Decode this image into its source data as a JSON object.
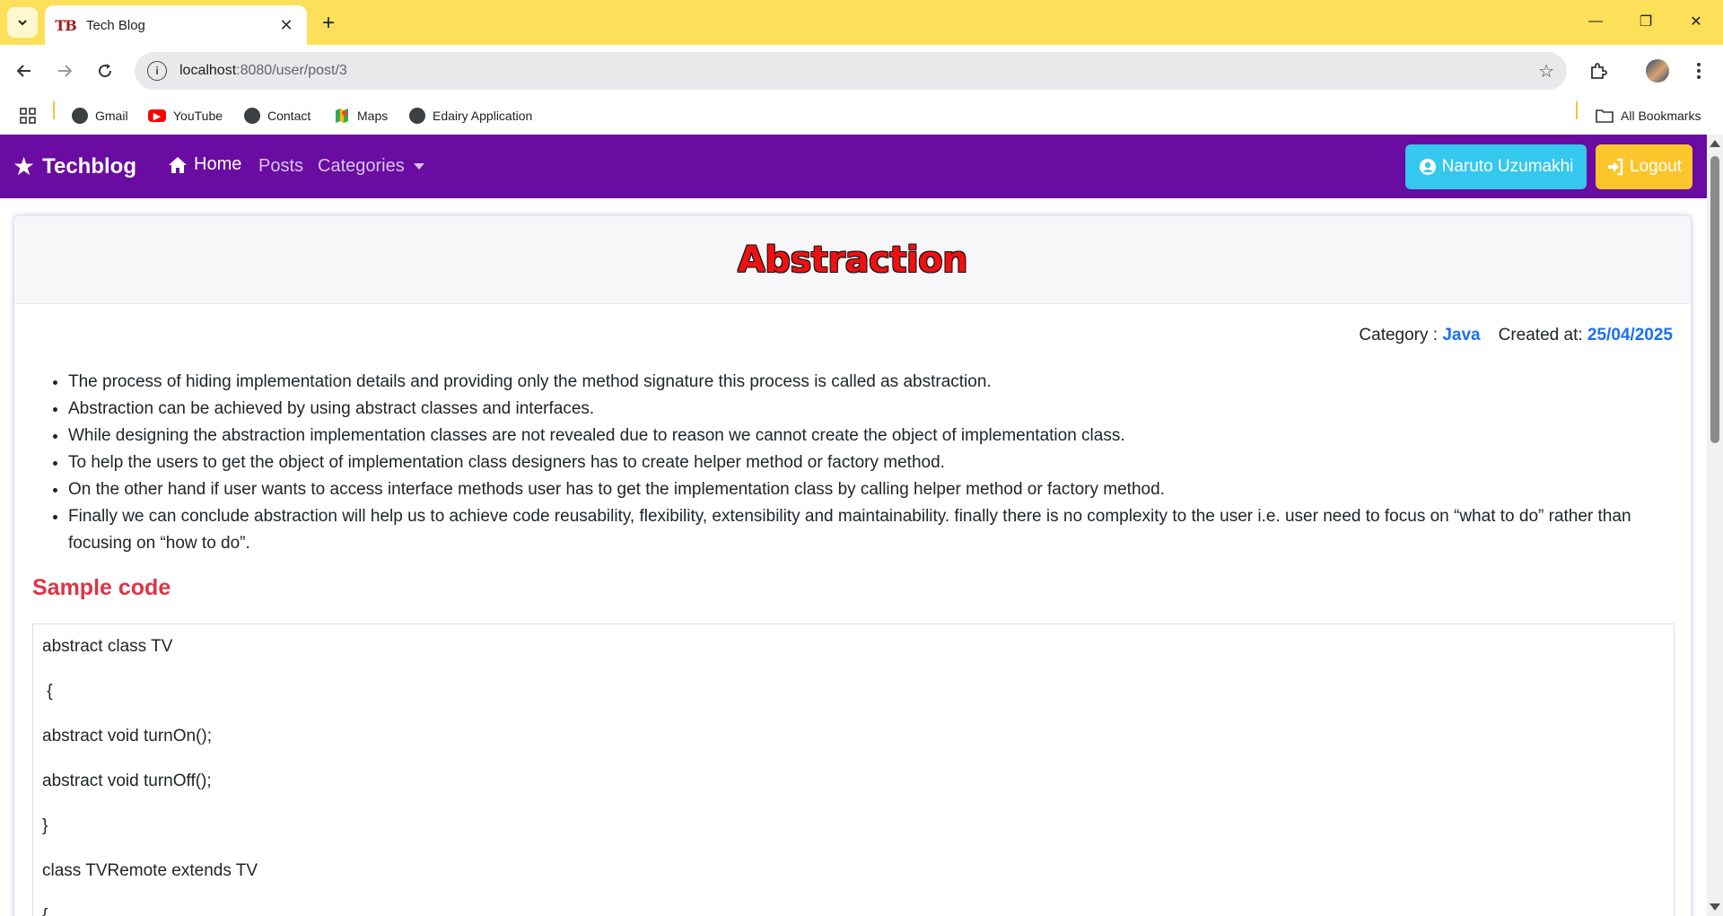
{
  "browser": {
    "tab_title": "Tech Blog",
    "tab_favicon_text": "TB",
    "url_host": "localhost",
    "url_rest": ":8080/user/post/3",
    "bookmarks": [
      {
        "label": "Gmail",
        "icon": "gmail-icon"
      },
      {
        "label": "YouTube",
        "icon": "youtube-icon"
      },
      {
        "label": "Contact",
        "icon": "globe-icon"
      },
      {
        "label": "Maps",
        "icon": "maps-icon"
      },
      {
        "label": "Edairy Application",
        "icon": "globe-icon"
      }
    ],
    "all_bookmarks": "All Bookmarks"
  },
  "navbar": {
    "brand": "Techblog",
    "home": "Home",
    "posts": "Posts",
    "categories": "Categories",
    "user_button": "Naruto Uzumakhi",
    "logout_button": "Logout",
    "color": "#6a0ba2"
  },
  "post": {
    "title": "Abstraction",
    "category_label": "Category :",
    "category_value": "Java",
    "created_label": "Created at:",
    "created_value": "25/04/2025",
    "bullets": [
      "The process of hiding implementation details and providing only the method signature this process is called as abstraction.",
      "Abstraction can be achieved by using abstract classes and interfaces.",
      "While designing the abstraction implementation classes are not revealed due to reason we cannot create the object of implementation class.",
      "To help the users to get the object of implementation class designers has to create helper method or factory method.",
      "On the other hand if user wants to access interface methods user has to get the implementation class by calling helper method or factory method.",
      "Finally we can conclude abstraction will help us to achieve code reusability, flexibility, extensibility and maintainability. finally there is no complexity to the user i.e. user need to focus on “what to do” rather than focusing on “how to do”."
    ],
    "sample_heading": "Sample code",
    "code_lines": [
      "abstract class TV",
      " {",
      "abstract void turnOn();",
      "abstract void turnOff();",
      "}",
      "class TVRemote extends TV",
      "{"
    ]
  }
}
